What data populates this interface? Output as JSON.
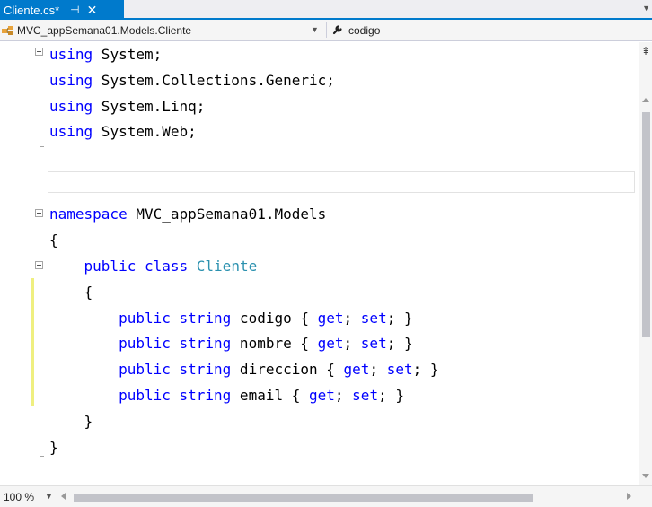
{
  "tab": {
    "title": "Cliente.cs*",
    "pin_icon": "pin-icon",
    "close_icon": "close-icon",
    "accent": "#007acc"
  },
  "navbar": {
    "type_selector": "MVC_appSemana01.Models.Cliente",
    "member_selector": "codigo",
    "class_icon": "class-icon",
    "member_icon": "wrench-icon"
  },
  "editor": {
    "lines": [
      [
        {
          "t": "using",
          "c": "kw"
        },
        {
          "t": " System;"
        }
      ],
      [
        {
          "t": "using",
          "c": "kw"
        },
        {
          "t": " System.Collections.Generic;"
        }
      ],
      [
        {
          "t": "using",
          "c": "kw"
        },
        {
          "t": " System.Linq;"
        }
      ],
      [
        {
          "t": "using",
          "c": "kw"
        },
        {
          "t": " System.Web;"
        }
      ],
      [],
      [
        {
          "t": "namespace",
          "c": "kw"
        },
        {
          "t": " MVC_appSemana01.Models"
        }
      ],
      [
        {
          "t": "{"
        }
      ],
      [
        {
          "t": "    "
        },
        {
          "t": "public",
          "c": "kw"
        },
        {
          "t": " "
        },
        {
          "t": "class",
          "c": "kw"
        },
        {
          "t": " "
        },
        {
          "t": "Cliente",
          "c": "type"
        }
      ],
      [
        {
          "t": "    {"
        }
      ],
      [
        {
          "t": "        "
        },
        {
          "t": "public",
          "c": "kw"
        },
        {
          "t": " "
        },
        {
          "t": "string",
          "c": "kw"
        },
        {
          "t": " codigo { "
        },
        {
          "t": "get",
          "c": "kw"
        },
        {
          "t": "; "
        },
        {
          "t": "set",
          "c": "kw"
        },
        {
          "t": "; }"
        }
      ],
      [
        {
          "t": "        "
        },
        {
          "t": "public",
          "c": "kw"
        },
        {
          "t": " "
        },
        {
          "t": "string",
          "c": "kw"
        },
        {
          "t": " nombre { "
        },
        {
          "t": "get",
          "c": "kw"
        },
        {
          "t": "; "
        },
        {
          "t": "set",
          "c": "kw"
        },
        {
          "t": "; }"
        }
      ],
      [
        {
          "t": "        "
        },
        {
          "t": "public",
          "c": "kw"
        },
        {
          "t": " "
        },
        {
          "t": "string",
          "c": "kw"
        },
        {
          "t": " direccion { "
        },
        {
          "t": "get",
          "c": "kw"
        },
        {
          "t": "; "
        },
        {
          "t": "set",
          "c": "kw"
        },
        {
          "t": "; }"
        }
      ],
      [
        {
          "t": "        "
        },
        {
          "t": "public",
          "c": "kw"
        },
        {
          "t": " "
        },
        {
          "t": "string",
          "c": "kw"
        },
        {
          "t": " email { "
        },
        {
          "t": "get",
          "c": "kw"
        },
        {
          "t": "; "
        },
        {
          "t": "set",
          "c": "kw"
        },
        {
          "t": "; }"
        }
      ],
      [
        {
          "t": "    }"
        }
      ],
      [
        {
          "t": "}"
        }
      ]
    ],
    "keyword_color": "#0000ff",
    "type_color": "#2b91af",
    "change_marker_color": "#efef80"
  },
  "status": {
    "zoom": "100 %"
  }
}
